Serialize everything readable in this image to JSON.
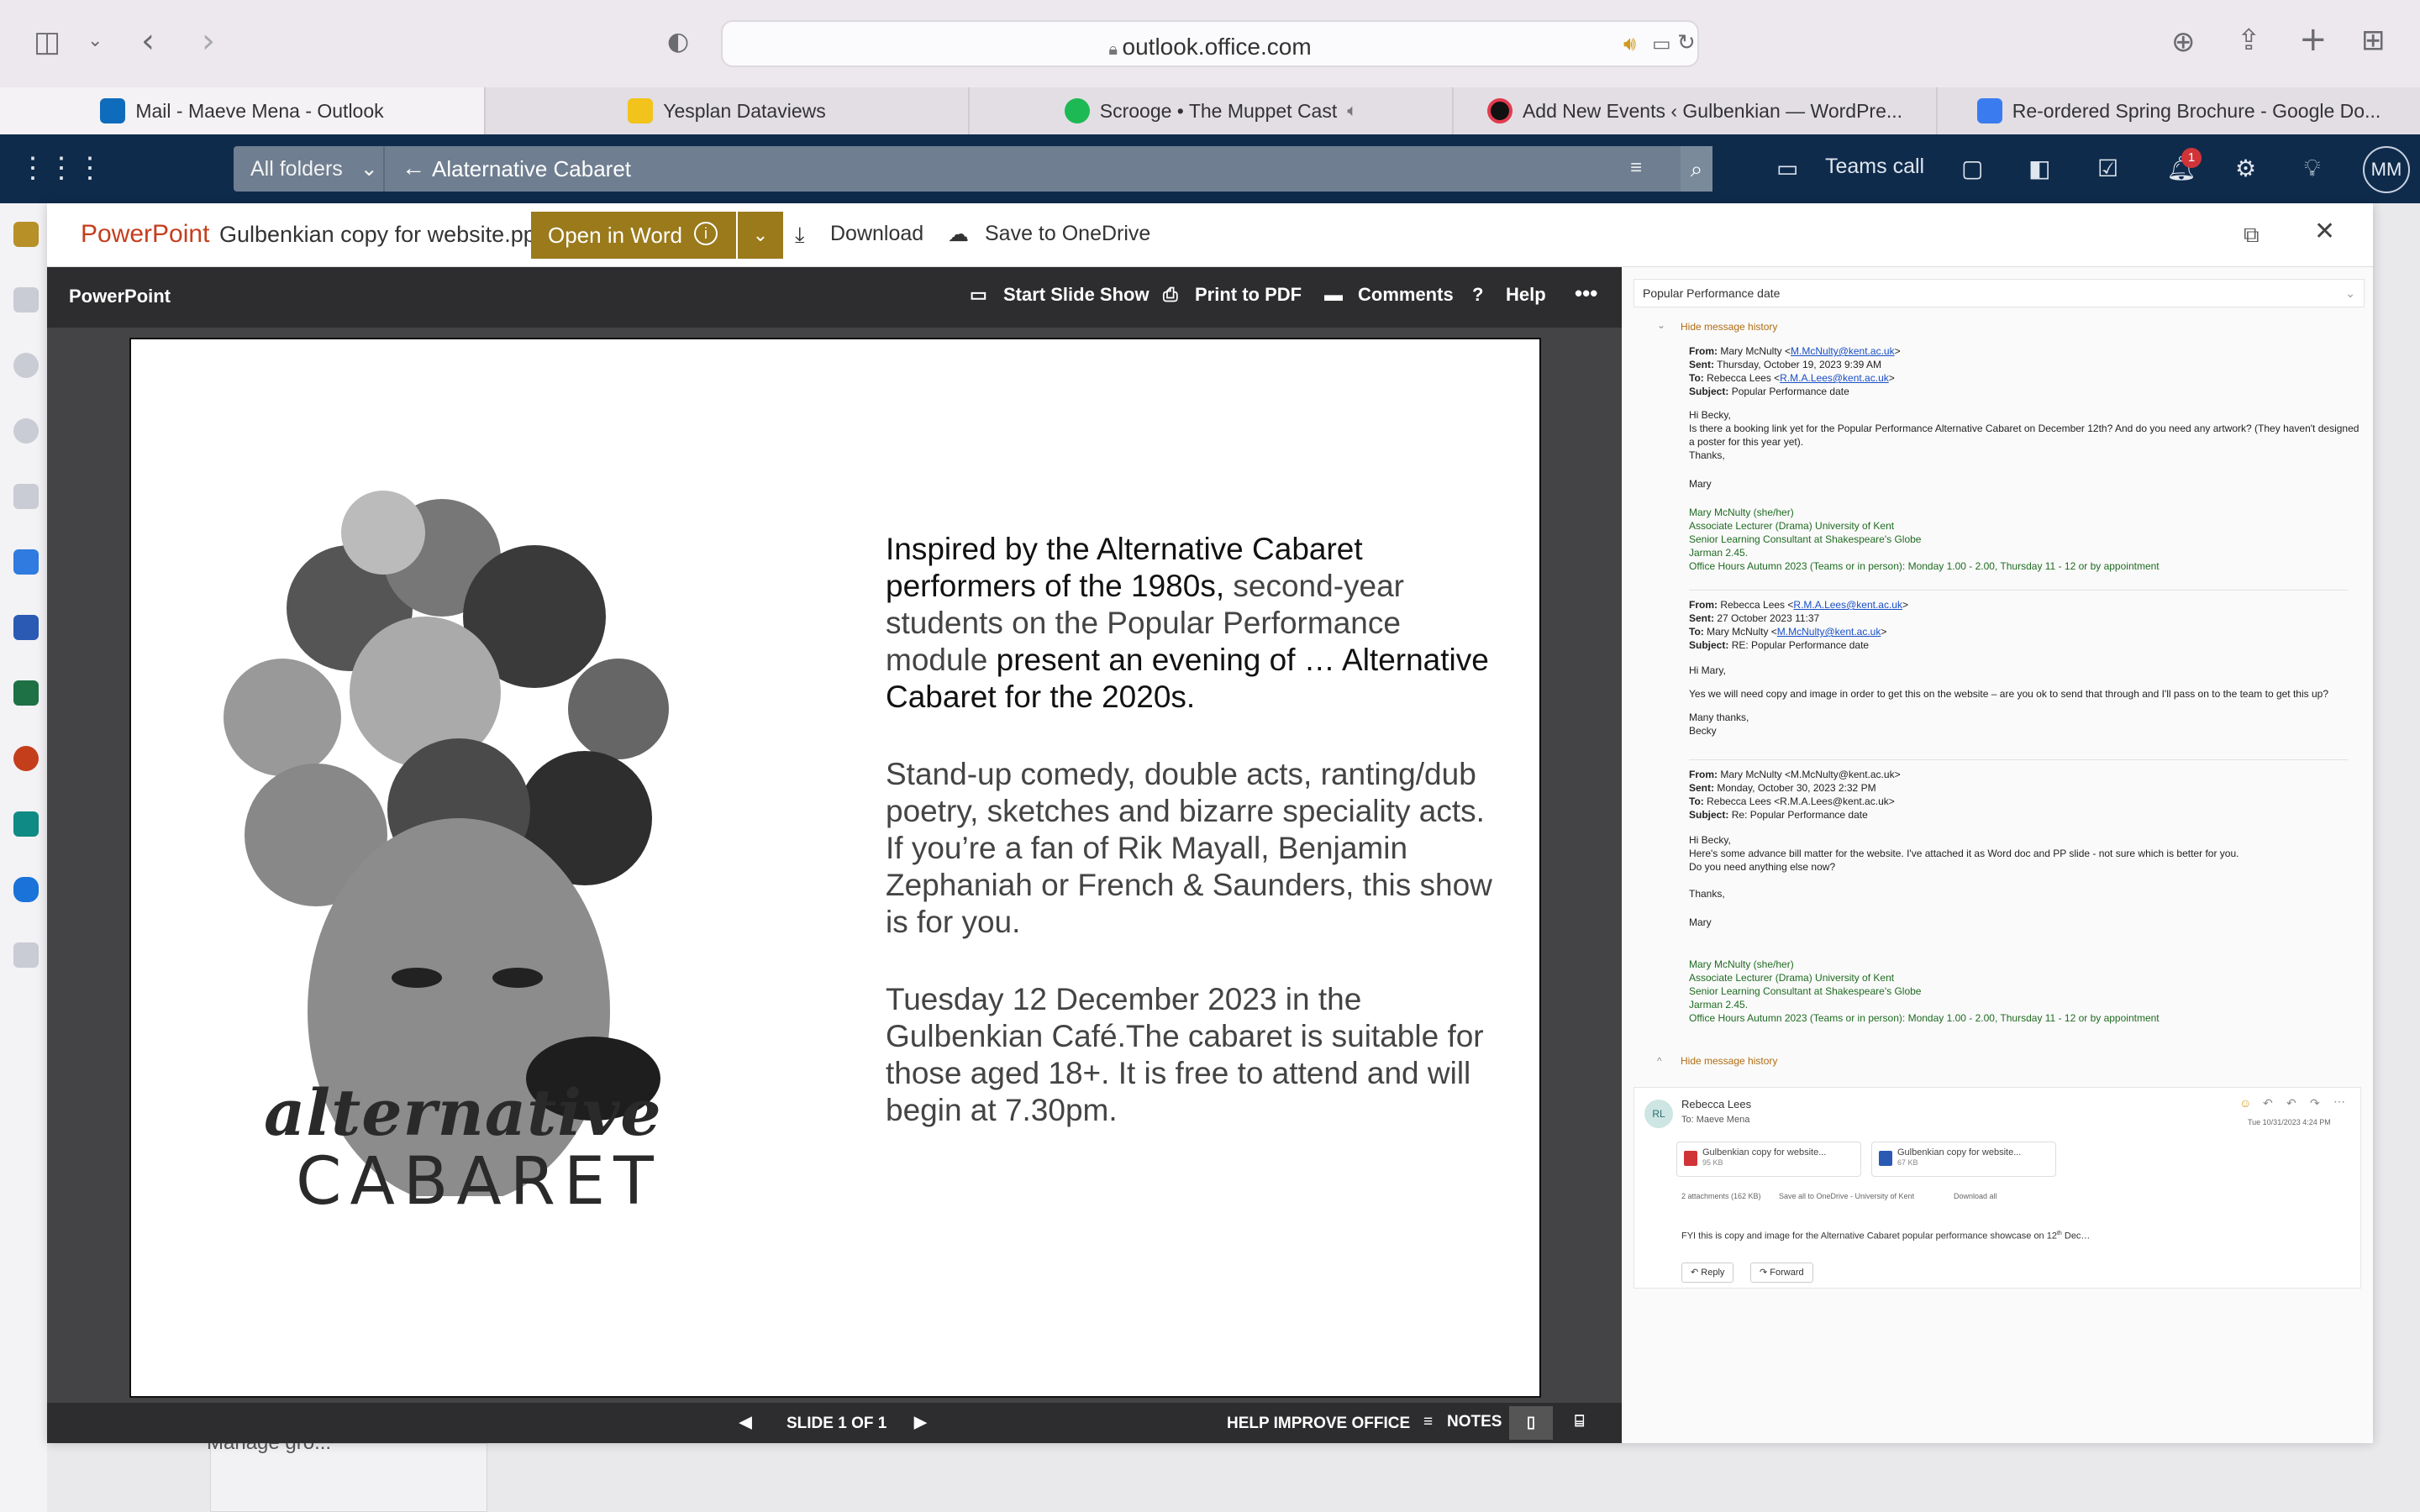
{
  "browser": {
    "url": "outlook.office.com",
    "tabs": [
      {
        "label": "Mail - Maeve Mena - Outlook",
        "icon": "outlook-icon"
      },
      {
        "label": "Yesplan Dataviews",
        "icon": "yesplan-icon"
      },
      {
        "label": "Scrooge • The Muppet Cast",
        "icon": "spotify-icon"
      },
      {
        "label": "Add New Events ‹ Gulbenkian — WordPre...",
        "icon": "wordpress-icon"
      },
      {
        "label": "Re-ordered Spring Brochure - Google Do...",
        "icon": "google-docs-icon"
      }
    ]
  },
  "outlook": {
    "folder_select": "All folders",
    "search_query": "Alaternative Cabaret",
    "teams_call": "Teams call",
    "notification_count": "1",
    "user_initials": "MM",
    "below_text": "Manage gro..."
  },
  "viewer": {
    "app": "PowerPoint",
    "file_name": "Gulbenkian copy for website.pptx",
    "open_in_word": "Open in Word",
    "download": "Download",
    "save_onedrive": "Save to OneDrive"
  },
  "ppt": {
    "label": "PowerPoint",
    "start_slide_show": "Start Slide Show",
    "print_pdf": "Print to PDF",
    "comments": "Comments",
    "help": "Help",
    "slide_counter": "SLIDE 1 OF 1",
    "help_improve": "HELP IMPROVE OFFICE",
    "notes": "NOTES"
  },
  "slide": {
    "p1a": "Inspired by the Alternative Cabaret performers of the 1980s,",
    "p1b": " second-year students on the Popular Performance module",
    "p1c": " present an evening of … Alternative Cabaret for the 2020s.",
    "p2": "Stand-up comedy, double acts, ranting/dub poetry, sketches and bizarre speciality acts. If you’re a fan of Rik Mayall, Benjamin Zephaniah or French & Saunders, this show is for you.",
    "p3": "Tuesday 12 December 2023 in the Gulbenkian Café.The cabaret is suitable for those aged 18+. It is free to attend and will begin at 7.30pm.",
    "logo_line1": "alternative",
    "logo_line2": "CABARET"
  },
  "email": {
    "subject": "Popular Performance date",
    "hide_history": "Hide message history",
    "m1": {
      "from_label": "From:",
      "from": "Mary McNulty <",
      "from_email": "M.McNulty@kent.ac.uk",
      "from_end": ">",
      "sent_label": "Sent:",
      "sent": "Thursday, October 19, 2023 9:39 AM",
      "to_label": "To:",
      "to": "Rebecca Lees <",
      "to_email": "R.M.A.Lees@kent.ac.uk",
      "to_end": ">",
      "subject_label": "Subject:",
      "subject": "Popular Performance date",
      "greeting": "Hi Becky,",
      "body": "Is there a booking link yet for the Popular Performance Alternative Cabaret on December 12th? And do you need any artwork? (They haven't designed a poster for this year yet).",
      "thanks": "Thanks,",
      "name": "Mary"
    },
    "sig": {
      "l1": "Mary McNulty (she/her)",
      "l2": "Associate Lecturer (Drama) University of Kent",
      "l3": "Senior Learning Consultant at Shakespeare's Globe",
      "l4": "Jarman 2.45.",
      "l5": "Office Hours Autumn 2023 (Teams or in person): Monday 1.00 - 2.00, Thursday 11 - 12 or by appointment"
    },
    "m2": {
      "from_label": "From:",
      "from": "Rebecca Lees <",
      "from_email": "R.M.A.Lees@kent.ac.uk",
      "from_end": ">",
      "sent_label": "Sent:",
      "sent": "27 October 2023 11:37",
      "to_label": "To:",
      "to": "Mary McNulty <",
      "to_email": "M.McNulty@kent.ac.uk",
      "to_end": ">",
      "subject_label": "Subject:",
      "subject": "RE: Popular Performance date",
      "greeting": "Hi Mary,",
      "body": "Yes we will need copy and image in order to get this on the website – are you ok to send that through and I'll pass on to the team to get this up?",
      "thanks": "Many thanks,",
      "name": "Becky"
    },
    "m3": {
      "from_label": "From:",
      "from": "Mary McNulty <M.McNulty@kent.ac.uk>",
      "sent_label": "Sent:",
      "sent": "Monday, October 30, 2023 2:32 PM",
      "to_label": "To:",
      "to": "Rebecca Lees <R.M.A.Lees@kent.ac.uk>",
      "subject_label": "Subject:",
      "subject": "Re: Popular Performance date",
      "greeting": "Hi Becky,",
      "body": "Here's some advance bill matter for the website. I've attached it as Word doc and PP slide - not sure which is better for you.",
      "body2": "Do you need anything else now?",
      "thanks": "Thanks,",
      "name": "Mary"
    },
    "reply": {
      "initials": "RL",
      "sender": "Rebecca Lees",
      "to": "To:  Maeve Mena",
      "date": "Tue 10/31/2023 4:24 PM",
      "att1": "Gulbenkian copy for website...",
      "att1_size": "95 KB",
      "att2": "Gulbenkian copy for website...",
      "att2_size": "67 KB",
      "att_summary": "2 attachments (162 KB)",
      "save_all": "Save all to OneDrive - University of Kent",
      "download_all": "Download all",
      "body": "FYI this is copy and image for the Alternative Cabaret popular performance showcase on 12",
      "body_sup": "th",
      "body_end": " Dec…",
      "reply_btn": "Reply",
      "forward_btn": "Forward"
    }
  }
}
